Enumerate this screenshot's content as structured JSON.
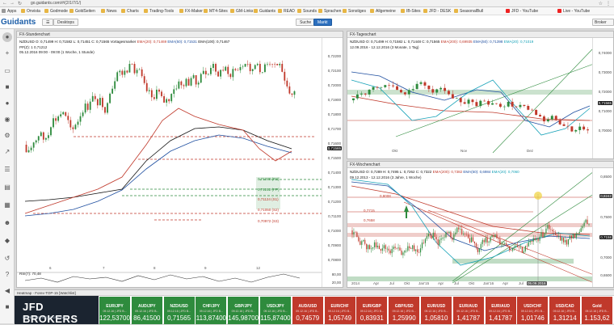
{
  "browser": {
    "url": "go.guidants.com/#/(2/1/7/1/)",
    "bookmarks": [
      "Apps",
      "Onvista",
      "Godmode",
      "GoldSeiten",
      "News",
      "Charts",
      "Trading-Tools",
      "FX-Maker",
      "MT4-Sites",
      "GM-Links",
      "Guidants",
      "READ",
      "Sounds",
      "Sprachen",
      "Sonstiges",
      "Allgemeine",
      "IB-Sites",
      "JFD - DESK",
      "SeasonalBull",
      "JFD - YouTube",
      "Live - YouTube"
    ]
  },
  "app": {
    "logo": "Guidants",
    "desktop_label": "Desktops",
    "search_label": "Suche",
    "market_label": "Markt",
    "broker_label": "Broker Log..."
  },
  "panels": {
    "hourly": {
      "title": "FX-Stundenchart",
      "line1": "NZDUSD  O: 0,71499  H: 0,71582  L: 0,71451  C: 0,71565  Vortagesmarker",
      "ema20": "EMA(20): 0,71469",
      "ema50": "EMA(50): 0,71531",
      "ema100": "EMA(100): 0,71467",
      "line2": "PP(Z): 1  0,71212",
      "line3": "05.12.2016 09:00 - 09:00  (1 Woche, 1 Stunde)",
      "price_tag": "0,71565",
      "yticks": [
        "0,72200",
        "0,72100",
        "0,72000",
        "0,71900",
        "0,71800",
        "0,71700",
        "0,71600",
        "0,71500",
        "0,71400",
        "0,71300",
        "0,71200",
        "0,71100",
        "0,71000",
        "0,70900",
        "0,70800",
        "0,70700",
        "0,70600"
      ],
      "xticks": [
        "6",
        "7",
        "8",
        "9",
        "12"
      ],
      "levels": [
        "0,71378 (R3)",
        "0,71212 (PP)",
        "0,71124 (S1)",
        "0,71050 (S2)",
        "0,70972 (S3)"
      ],
      "rsi_label": "RSI(7): 70,48",
      "rsi_ticks": [
        "80,00",
        "20,00"
      ]
    },
    "daily": {
      "title": "FX-Tageschart",
      "line1": "NZDUSD  O: 0,71499  H: 0,71582  L: 0,71448  C: 0,71565",
      "ema200": "EMA(200): 0,69935",
      "ema50": "EMA(50): 0,71398",
      "ema20": "EMA(20): 0,71019",
      "line2": "12.09.2016 - 12.12.2016  (3 Monate, 1 Tag)",
      "price_tag": "0,71565",
      "yticks": [
        "0,74000",
        "0,73000",
        "0,72000",
        "0,71000",
        "0,70000",
        "0,69000"
      ],
      "xticks": [
        "Okt",
        "Nov",
        "Dez"
      ]
    },
    "weekly": {
      "title": "FX-Wochenchart",
      "line1": "NZDUSD  O: 0,7289  H: 0,7495  L: 0,7262  C: 0,7322",
      "ema200": "EMA(200): 0,7382",
      "ema50": "EMA(50): 0,6984",
      "ema20": "EMA(20): 0,7060",
      "line2": "09.12.2013 - 12.12.2016  (3 Jahre, 1 Woche)",
      "price_tag": "0,7158",
      "ref_tag": "0,8242",
      "yticks": [
        "0,8500",
        "0,8000",
        "0,7500",
        "0,7000",
        "0,6500"
      ],
      "xticks": [
        "2014",
        "Apr",
        "Jul",
        "Okt",
        "Jan'15",
        "Apr",
        "Jul",
        "Okt",
        "Jan'16",
        "Apr",
        "Jul"
      ],
      "date_tag": "05.09.2016",
      "marks": [
        "0,8008",
        "0,7715",
        "0,7658"
      ]
    }
  },
  "watchlist": {
    "header": "Heatmap - Forex-TOP-15  [Watchlist]",
    "brand": "JFD BROKERS",
    "brand_tagline": "SEIZE THE FAIR ADVANTAGE",
    "tiles": [
      {
        "sym": "EUR/JPY",
        "sub": "09.12.16 | JFD B...",
        "val": "122,53700",
        "color": "green"
      },
      {
        "sym": "AUD/JPY",
        "sub": "09.12.16 | JFD B...",
        "val": "86,41500",
        "color": "green"
      },
      {
        "sym": "NZD/USD",
        "sub": "09.12.16 | JFD B...",
        "val": "0,71565",
        "color": "green"
      },
      {
        "sym": "CHF/JPY",
        "sub": "09.12.16 | JFD B...",
        "val": "113,87400",
        "color": "green"
      },
      {
        "sym": "GBP/JPY",
        "sub": "09.12.16 | JFD B...",
        "val": "145,98700",
        "color": "green"
      },
      {
        "sym": "USD/JPY",
        "sub": "09.12.16 | JFD B...",
        "val": "115,87400",
        "color": "green"
      },
      {
        "sym": "AUD/USD",
        "sub": "09.12.16 | JFD B...",
        "val": "0,74579",
        "color": "red"
      },
      {
        "sym": "EUR/CHF",
        "sub": "09.12.16 | JFD B...",
        "val": "1,05749",
        "color": "red"
      },
      {
        "sym": "EUR/GBP",
        "sub": "09.12.16 | JFD B...",
        "val": "0,83931",
        "color": "red"
      },
      {
        "sym": "GBP/USD",
        "sub": "09.12.16 | JFD B...",
        "val": "1,25990",
        "color": "red"
      },
      {
        "sym": "EUR/USD",
        "sub": "09.12.16 | JFD B...",
        "val": "1,05810",
        "color": "red"
      },
      {
        "sym": "EUR/AUD",
        "sub": "09.12.16 | JFD B...",
        "val": "1,41787",
        "color": "red"
      },
      {
        "sym": "EUR/AUD",
        "sub": "09.12.16 | JFD B...",
        "val": "1,41787",
        "color": "red"
      },
      {
        "sym": "USD/CHF",
        "sub": "09.12.16 | JFD B...",
        "val": "1,01746",
        "color": "red"
      },
      {
        "sym": "USD/CAD",
        "sub": "09.12.16 | JFD B...",
        "val": "1,31214",
        "color": "red"
      },
      {
        "sym": "Gold",
        "sub": "09.12.16 | JFD B...",
        "val": "1.153,62",
        "color": "red"
      }
    ]
  },
  "colors": {
    "candle_up": "#2e8b3d",
    "candle_down": "#c0392b",
    "ema_red": "#c0392b",
    "ema_blue": "#1f4fa0",
    "ema_black": "#111111",
    "ema_teal": "#17a2b8",
    "tag_blue": "#1a1a1a"
  }
}
